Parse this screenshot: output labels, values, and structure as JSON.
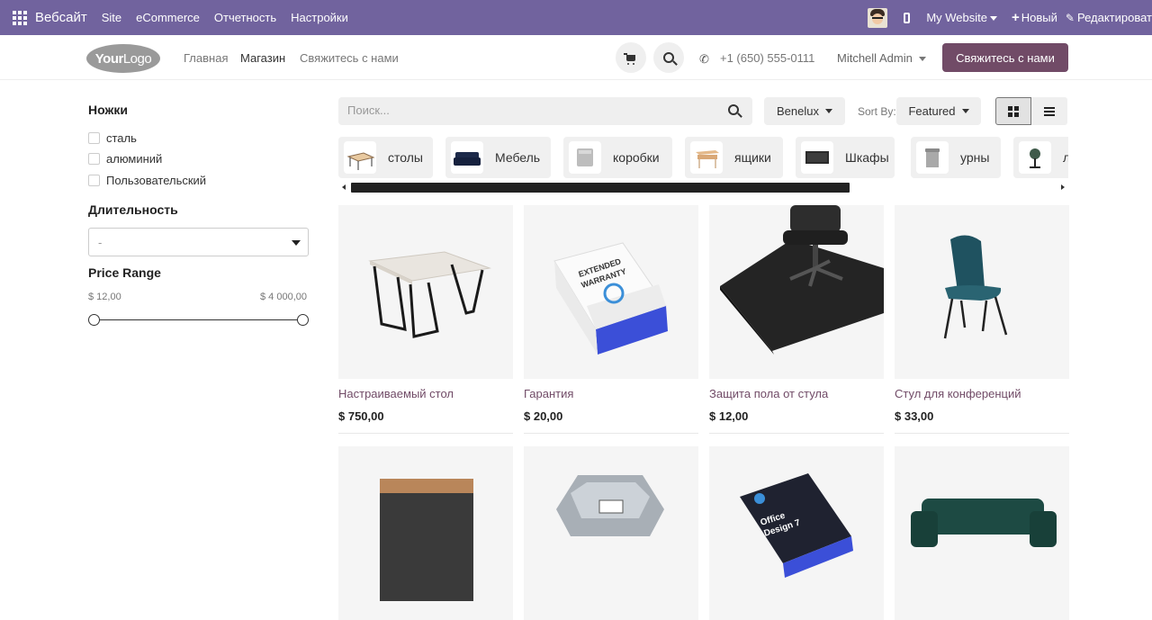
{
  "admin_bar": {
    "brand": "Вебсайт",
    "menu": [
      "Site",
      "eCommerce",
      "Отчетность",
      "Настройки"
    ],
    "my_website": "My Website",
    "new_label": "Новый",
    "edit_label": "Редактироват"
  },
  "header": {
    "logo": {
      "bold": "Your",
      "rest": "Logo"
    },
    "nav": [
      "Главная",
      "Магазин",
      "Свяжитесь с нами"
    ],
    "phone": "+1 (650) 555-0111",
    "user": "Mitchell Admin",
    "cta": "Свяжитесь с нами"
  },
  "sidebar": {
    "legs_title": "Ножки",
    "legs_options": [
      "сталь",
      "алюминий",
      "Пользовательский"
    ],
    "duration_title": "Длительность",
    "duration_value": "-",
    "price_title": "Price Range",
    "price_min": "$ 12,00",
    "price_max": "$ 4 000,00"
  },
  "toolbar": {
    "search_placeholder": "Поиск...",
    "pricelist": "Benelux",
    "sort_label": "Sort By:",
    "sort_value": "Featured"
  },
  "categories": [
    "столы",
    "Мебель",
    "коробки",
    "ящики",
    "Шкафы",
    "урны",
    "л"
  ],
  "products": [
    {
      "name": "Настраиваемый стол",
      "price": "$ 750,00"
    },
    {
      "name": "Гарантия",
      "price": "$ 20,00"
    },
    {
      "name": "Защита пола от стула",
      "price": "$ 12,00"
    },
    {
      "name": "Стул для конференций",
      "price": "$ 33,00"
    }
  ],
  "warranty_box_text": [
    "EXTENDED",
    "WARRANTY"
  ],
  "office_box_text": [
    "Office",
    "Design 7"
  ],
  "colors": {
    "admin_bar": "#71639e",
    "primary": "#714b67",
    "product_name": "#714b67"
  }
}
